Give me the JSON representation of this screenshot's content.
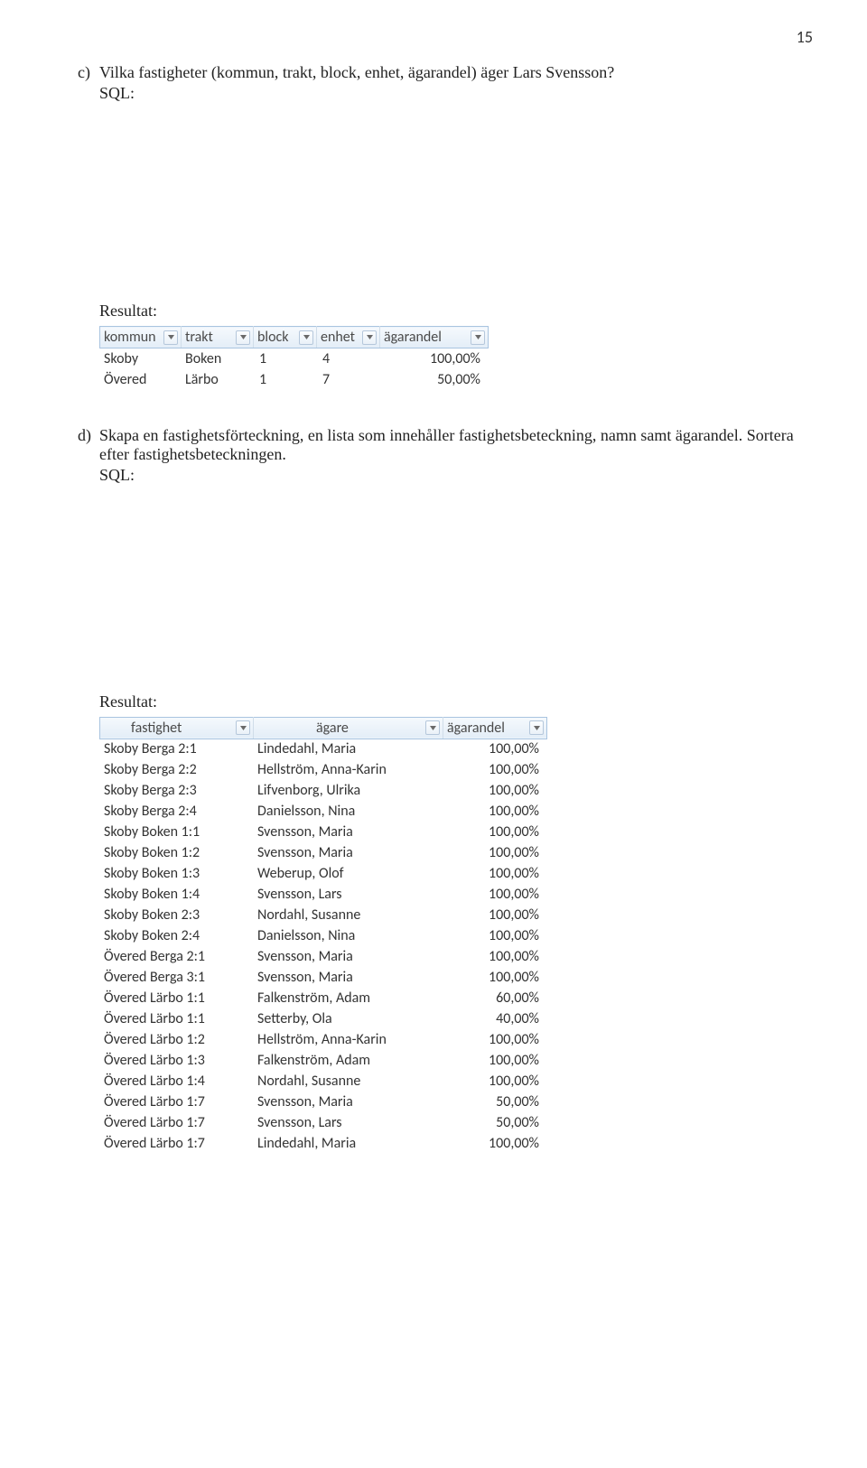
{
  "page_number": "15",
  "question_c": {
    "letter": "c)",
    "text": "Vilka fastigheter (kommun, trakt, block, enhet, ägarandel) äger Lars Svensson?",
    "sql_label": "SQL:",
    "result_label": "Resultat:"
  },
  "table1": {
    "headers": [
      "kommun",
      "trakt",
      "block",
      "enhet",
      "ägarandel"
    ],
    "rows": [
      {
        "kommun": "Skoby",
        "trakt": "Boken",
        "block": "1",
        "enhet": "4",
        "andel": "100,00%"
      },
      {
        "kommun": "Övered",
        "trakt": "Lärbo",
        "block": "1",
        "enhet": "7",
        "andel": "50,00%"
      }
    ]
  },
  "question_d": {
    "letter": "d)",
    "text": "Skapa en fastighetsförteckning, en lista som innehåller fastighetsbeteckning, namn samt ägarandel. Sortera efter fastighetsbeteckningen.",
    "sql_label": "SQL:",
    "result_label": "Resultat:"
  },
  "table2": {
    "headers": [
      "fastighet",
      "ägare",
      "ägarandel"
    ],
    "rows": [
      {
        "f": "Skoby Berga 2:1",
        "o": "Lindedahl, Maria",
        "a": "100,00%"
      },
      {
        "f": "Skoby Berga 2:2",
        "o": "Hellström, Anna-Karin",
        "a": "100,00%"
      },
      {
        "f": "Skoby Berga 2:3",
        "o": "Lifvenborg, Ulrika",
        "a": "100,00%"
      },
      {
        "f": "Skoby Berga 2:4",
        "o": "Danielsson, Nina",
        "a": "100,00%"
      },
      {
        "f": "Skoby Boken 1:1",
        "o": "Svensson, Maria",
        "a": "100,00%"
      },
      {
        "f": "Skoby Boken 1:2",
        "o": "Svensson, Maria",
        "a": "100,00%"
      },
      {
        "f": "Skoby Boken 1:3",
        "o": "Weberup, Olof",
        "a": "100,00%"
      },
      {
        "f": "Skoby Boken 1:4",
        "o": "Svensson, Lars",
        "a": "100,00%"
      },
      {
        "f": "Skoby Boken 2:3",
        "o": "Nordahl, Susanne",
        "a": "100,00%"
      },
      {
        "f": "Skoby Boken 2:4",
        "o": "Danielsson, Nina",
        "a": "100,00%"
      },
      {
        "f": "Övered Berga 2:1",
        "o": "Svensson, Maria",
        "a": "100,00%"
      },
      {
        "f": "Övered Berga 3:1",
        "o": "Svensson, Maria",
        "a": "100,00%"
      },
      {
        "f": "Övered Lärbo 1:1",
        "o": "Falkenström, Adam",
        "a": "60,00%"
      },
      {
        "f": "Övered Lärbo 1:1",
        "o": "Setterby, Ola",
        "a": "40,00%"
      },
      {
        "f": "Övered Lärbo 1:2",
        "o": "Hellström, Anna-Karin",
        "a": "100,00%"
      },
      {
        "f": "Övered Lärbo 1:3",
        "o": "Falkenström, Adam",
        "a": "100,00%"
      },
      {
        "f": "Övered Lärbo 1:4",
        "o": "Nordahl, Susanne",
        "a": "100,00%"
      },
      {
        "f": "Övered Lärbo 1:7",
        "o": "Svensson, Maria",
        "a": "50,00%"
      },
      {
        "f": "Övered Lärbo 1:7",
        "o": "Svensson, Lars",
        "a": "50,00%"
      },
      {
        "f": "Övered Lärbo 1:7",
        "o": "Lindedahl, Maria",
        "a": "100,00%"
      }
    ]
  }
}
